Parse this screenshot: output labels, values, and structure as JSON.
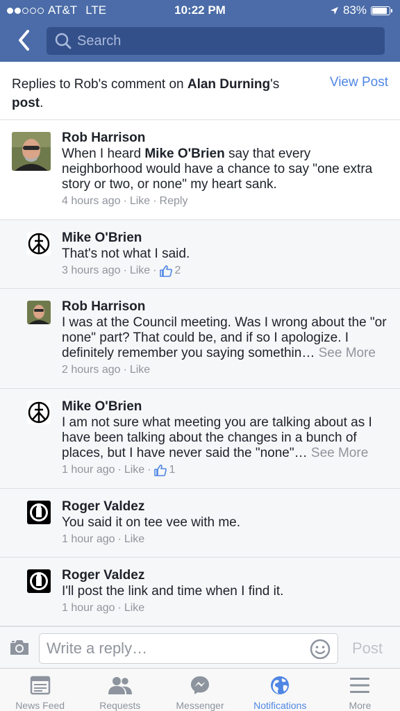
{
  "status_bar": {
    "carrier": "AT&T",
    "network": "LTE",
    "time": "10:22 PM",
    "battery": "83%",
    "signal_bars_filled": 2,
    "signal_bars_total": 5
  },
  "header": {
    "search_placeholder": "Search"
  },
  "context": {
    "prefix": "Replies to Rob's comment on ",
    "post_owner": "Alan Durning",
    "suffix_1": "'s",
    "suffix_2": "post",
    "suffix_3": ".",
    "view_post": "View Post"
  },
  "comments": [
    {
      "name": "Rob Harrison",
      "text_1": "When I heard ",
      "text_bold": "Mike O'Brien",
      "text_2": " say that every neighborhood would have a chance to say \"one extra story or two, or none\" my heart sank.",
      "time": "4 hours ago",
      "like": "Like",
      "reply": "Reply"
    },
    {
      "name": "Mike O'Brien",
      "text": "That's not what I said.",
      "time": "3 hours ago",
      "like": "Like",
      "likes": "2"
    },
    {
      "name": "Rob Harrison",
      "text": "I was at the Council meeting. Was I wrong about the \"or none\" part? That could be, and if so I apologize. I definitely remember you saying somethin…",
      "see_more": "See More",
      "time": "2 hours ago",
      "like": "Like"
    },
    {
      "name": "Mike O'Brien",
      "text": "I am not sure what meeting you are talking about as I have been talking about the changes in a bunch of places, but I have never said the \"none\"…",
      "see_more": "See More",
      "time": "1 hour ago",
      "like": "Like",
      "likes": "1"
    },
    {
      "name": "Roger Valdez",
      "text": "You said it on tee vee with me.",
      "time": "1 hour ago",
      "like": "Like"
    },
    {
      "name": "Roger Valdez",
      "text": "I'll post the link and time when I find it.",
      "time": "1 hour ago",
      "like": "Like"
    }
  ],
  "reply_bar": {
    "placeholder": "Write a reply…",
    "post": "Post"
  },
  "tabs": [
    {
      "label": "News Feed",
      "icon": "news-feed-icon"
    },
    {
      "label": "Requests",
      "icon": "friends-icon"
    },
    {
      "label": "Messenger",
      "icon": "messenger-icon"
    },
    {
      "label": "Notifications",
      "icon": "globe-icon",
      "active": true
    },
    {
      "label": "More",
      "icon": "menu-icon"
    }
  ],
  "colors": {
    "header_blue": "#4b6ca8",
    "search_bg": "#34508a",
    "link_blue": "#4e86e4",
    "meta_gray": "#90949c",
    "reply_bg": "#f6f7f9"
  }
}
